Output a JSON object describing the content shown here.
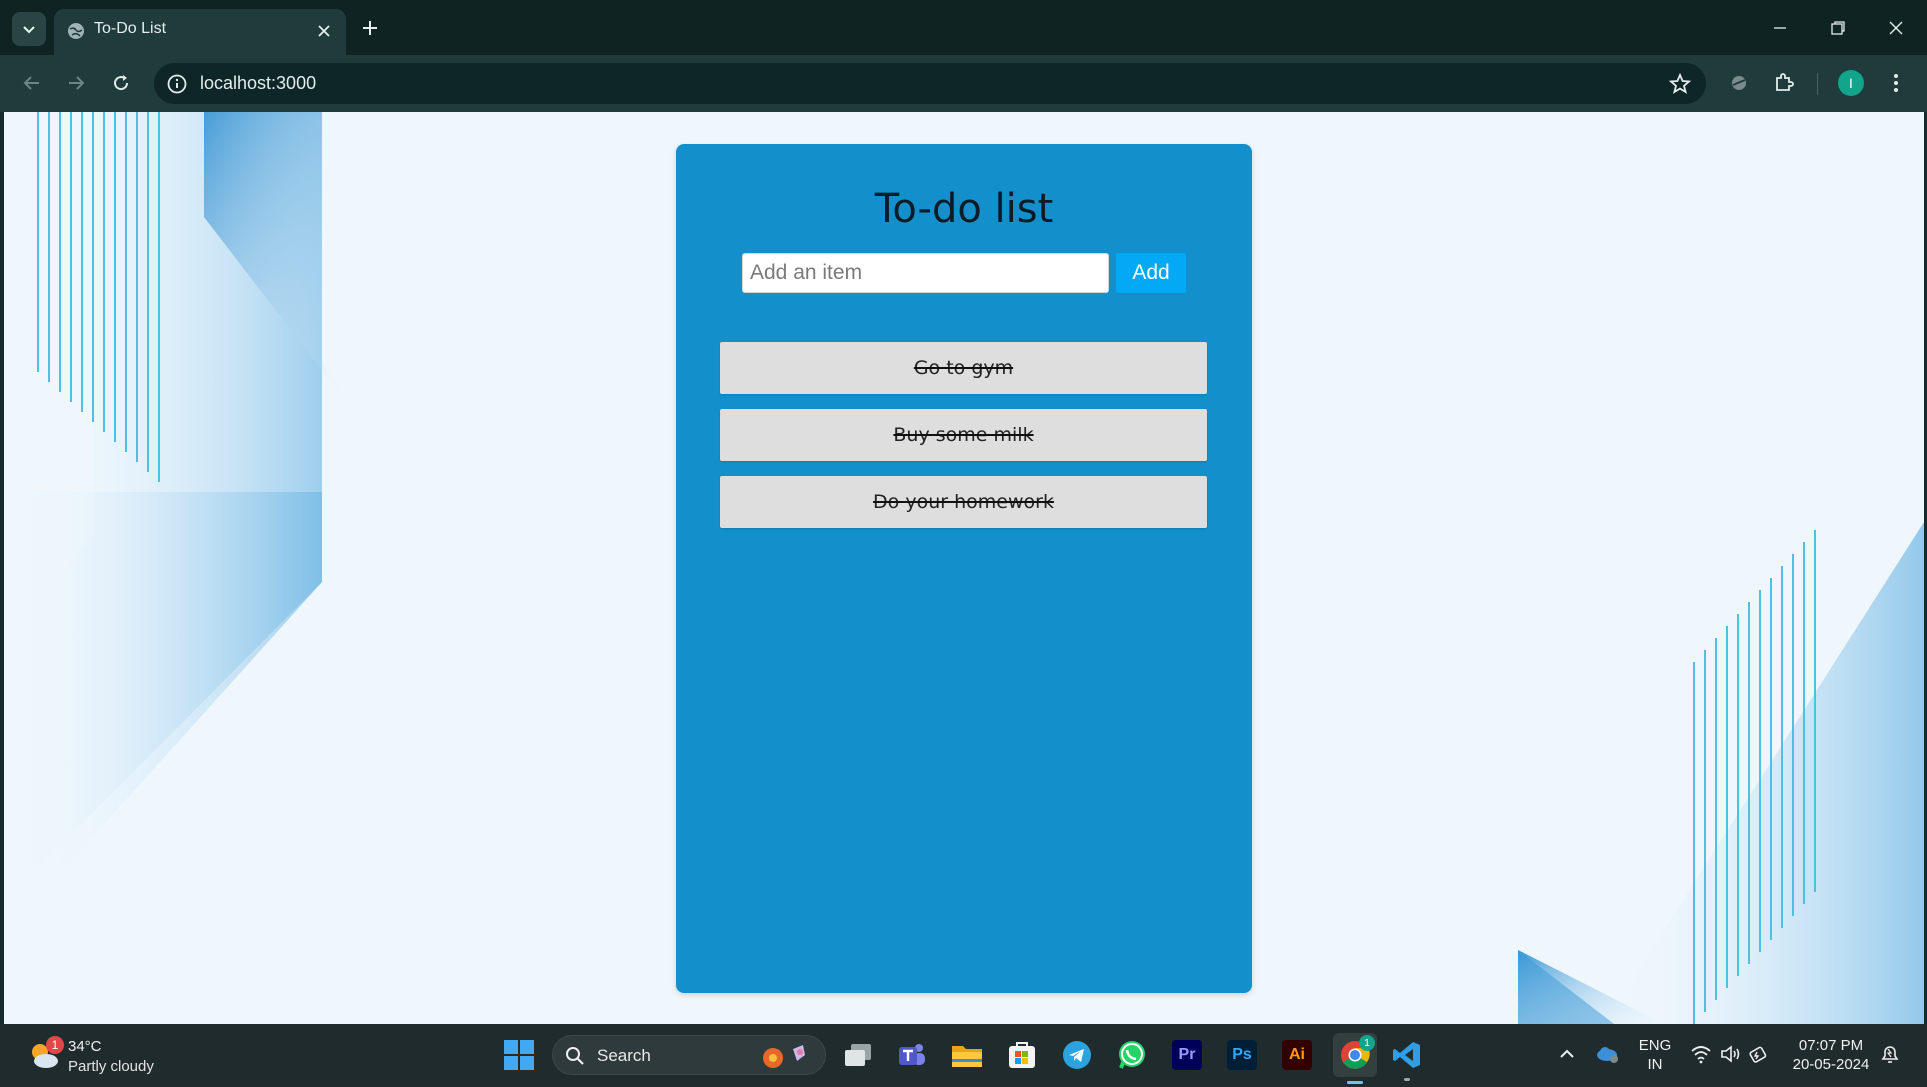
{
  "browser": {
    "tab_title": "To-Do List",
    "url": "localhost:3000",
    "profile_initial": "I"
  },
  "app": {
    "title": "To-do list",
    "input_placeholder": "Add an item",
    "input_value": "",
    "add_label": "Add",
    "items": [
      {
        "text": "Go to gym",
        "done": true
      },
      {
        "text": "Buy some milk",
        "done": true
      },
      {
        "text": "Do your homework",
        "done": true
      }
    ],
    "colors": {
      "card": "#1390cb",
      "add_button": "#03a9f4",
      "item_bg": "#dedede",
      "page_bg": "#eff7fd"
    }
  },
  "taskbar": {
    "weather_temp": "34°C",
    "weather_condition": "Partly cloudy",
    "weather_badge": "1",
    "search_label": "Search",
    "lang_line1": "ENG",
    "lang_line2": "IN",
    "time": "07:07 PM",
    "date": "20-05-2024",
    "chrome_badge": "1",
    "apps": [
      "task-view",
      "teams",
      "file-explorer",
      "microsoft-store",
      "telegram",
      "whatsapp",
      "premiere-pro",
      "photoshop",
      "illustrator",
      "chrome",
      "vs-code"
    ],
    "premiere_label": "Pr",
    "photoshop_label": "Ps",
    "illustrator_label": "Ai"
  }
}
